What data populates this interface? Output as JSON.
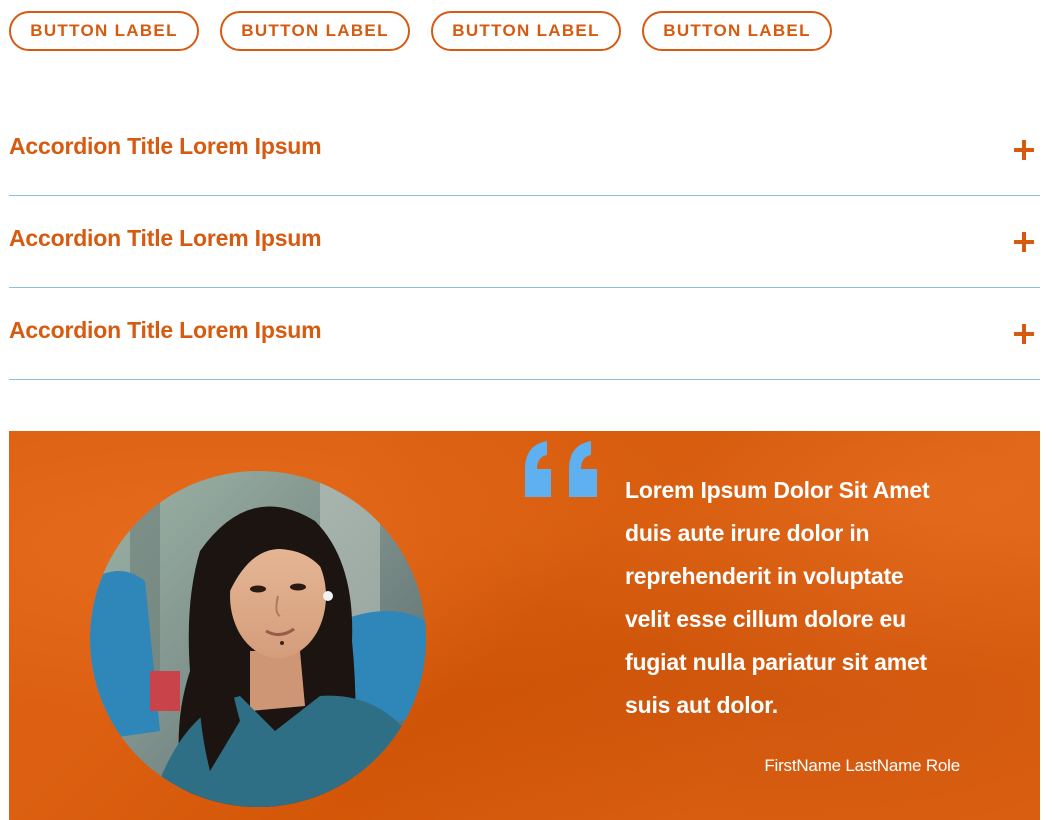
{
  "buttons": [
    {
      "label": "BUTTON LABEL"
    },
    {
      "label": "BUTTON LABEL"
    },
    {
      "label": "BUTTON LABEL"
    },
    {
      "label": "BUTTON LABEL"
    }
  ],
  "accordion": {
    "items": [
      {
        "title": "Accordion Title Lorem Ipsum",
        "icon": "plus-icon"
      },
      {
        "title": "Accordion Title Lorem Ipsum",
        "icon": "plus-icon"
      },
      {
        "title": "Accordion Title Lorem Ipsum",
        "icon": "plus-icon"
      }
    ]
  },
  "testimonial": {
    "quote_icon": "quote-icon",
    "quote_lines": [
      "Lorem Ipsum Dolor Sit Amet",
      "duis aute irure dolor in",
      "reprehenderit in voluptate",
      "velit esse cillum dolore eu",
      "fugiat nulla pariatur sit amet",
      "suis aut dolor."
    ],
    "author": "FirstName LastName Role"
  },
  "colors": {
    "accent": "#d65a0f",
    "testimonial_bg": "#dc5a08",
    "quote_mark": "#5fb0f0",
    "divider": "#8fbfd6"
  }
}
